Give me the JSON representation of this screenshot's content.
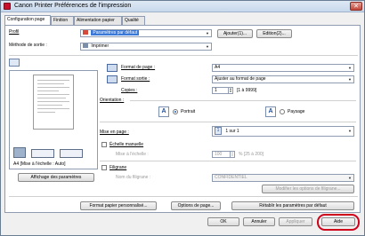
{
  "window": {
    "title": "Canon Printer Préférences de l'impression",
    "close_symbol": "✕"
  },
  "tabs": [
    {
      "label": "Configuration page",
      "active": true
    },
    {
      "label": "Finition",
      "active": false
    },
    {
      "label": "Alimentation papier",
      "active": false
    },
    {
      "label": "Qualité",
      "active": false
    }
  ],
  "profile": {
    "label": "Profil",
    "value": "Paramètres par défaut",
    "add_button": "Ajouter(1)...",
    "edit_button": "Edition(2)..."
  },
  "output_method": {
    "label": "Méthode de sortie :",
    "value": "Imprimer"
  },
  "preview": {
    "caption": "A4 [Mise à l'échelle : Auto]"
  },
  "page_format": {
    "label": "Format de page :",
    "value": "A4"
  },
  "output_format": {
    "label": "Format sortie :",
    "value": "Ajuster au format de page"
  },
  "copies": {
    "label": "Copies :",
    "value": "1",
    "range": "[1 à 9999]"
  },
  "orientation": {
    "label": "Orientation :",
    "portrait": "Portrait",
    "landscape": "Paysage",
    "selected": "portrait"
  },
  "layout": {
    "label": "Mise en page :",
    "value": "1 sur 1"
  },
  "scaling": {
    "checkbox_label": "Échelle manuelle",
    "scale_label": "Mise à l'échelle :",
    "scale_value": "100",
    "scale_range": "% [25 à 200]"
  },
  "watermark": {
    "checkbox_label": "Filigrane",
    "name_label": "Nom du filigrane :",
    "name_value": "CONFIDENTIEL",
    "edit_button": "Modifier les options de filigrane..."
  },
  "settings_display_button": "Affichage des paramètres",
  "bottom_buttons": {
    "custom_paper": "Format papier personnalisé...",
    "page_options": "Options de page...",
    "restore_defaults": "Rétablir les paramètres par défaut"
  },
  "dialog_buttons": {
    "ok": "OK",
    "cancel": "Annuler",
    "apply": "Appliquer",
    "help": "Aide"
  },
  "colors": {
    "highlight_ring": "#d0021b",
    "selected_combo": "#3a78d8"
  }
}
